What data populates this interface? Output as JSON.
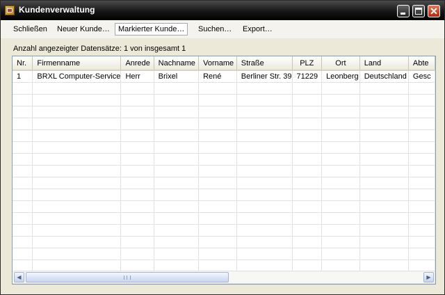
{
  "window": {
    "title": "Kundenverwaltung"
  },
  "menu": {
    "close": "Schließen",
    "new_customer": "Neuer Kunde…",
    "marked_customer": "Markierter Kunde…",
    "search": "Suchen…",
    "export": "Export…"
  },
  "status": {
    "text": "Anzahl angezeigter Datensätze: 1 von insgesamt 1"
  },
  "table": {
    "columns": [
      "Nr.",
      "Firmenname",
      "Anrede",
      "Nachname",
      "Vorname",
      "Straße",
      "PLZ",
      "Ort",
      "Land",
      "Abte"
    ],
    "rows": [
      [
        "1",
        "BRXL Computer-Service",
        "Herr",
        "Brixel",
        "René",
        "Berliner Str. 39",
        "71229",
        "Leonberg",
        "Deutschland",
        "Gesc"
      ]
    ]
  }
}
